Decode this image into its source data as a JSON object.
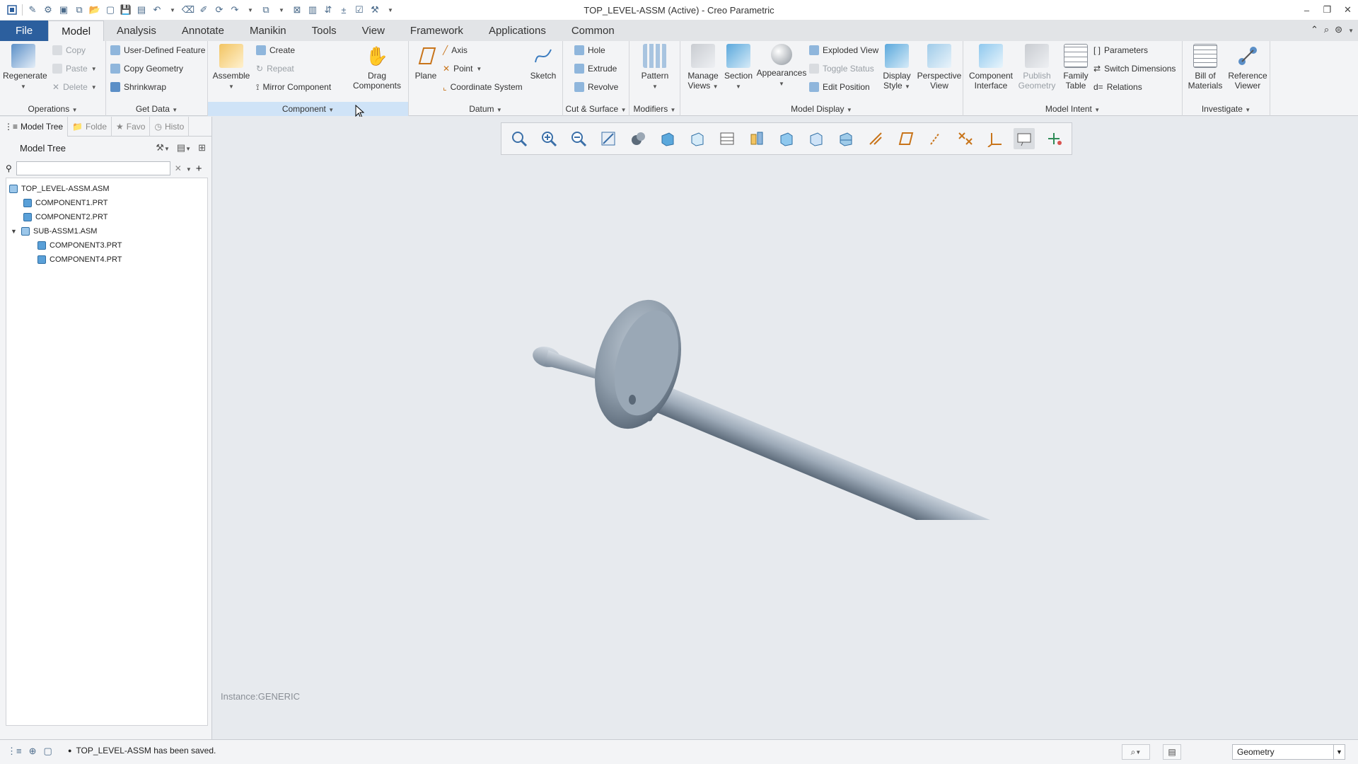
{
  "window": {
    "title": "TOP_LEVEL-ASSM (Active) - Creo Parametric",
    "controls": [
      "–",
      "❐",
      "✕"
    ]
  },
  "tabs": [
    "File",
    "Model",
    "Analysis",
    "Annotate",
    "Manikin",
    "Tools",
    "View",
    "Framework",
    "Applications",
    "Common"
  ],
  "active_tab": "Model",
  "ribbon": {
    "operations": {
      "label": "Operations",
      "regenerate": "Regenerate",
      "copy": "Copy",
      "paste": "Paste",
      "delete": "Delete"
    },
    "get_data": {
      "label": "Get Data",
      "udf": "User-Defined Feature",
      "copy_geometry": "Copy Geometry",
      "shrinkwrap": "Shrinkwrap"
    },
    "component": {
      "label": "Component",
      "assemble": "Assemble",
      "create": "Create",
      "repeat": "Repeat",
      "mirror": "Mirror Component",
      "drag_1": "Drag",
      "drag_2": "Components"
    },
    "datum": {
      "label": "Datum",
      "plane": "Plane",
      "axis": "Axis",
      "point": "Point",
      "csys": "Coordinate System",
      "sketch": "Sketch"
    },
    "cut_surface": {
      "label": "Cut & Surface",
      "hole": "Hole",
      "extrude": "Extrude",
      "revolve": "Revolve"
    },
    "modifiers": {
      "label": "Modifiers",
      "pattern": "Pattern"
    },
    "model_display": {
      "label": "Model Display",
      "manage_1": "Manage",
      "manage_2": "Views",
      "section": "Section",
      "appearances": "Appearances",
      "exploded": "Exploded View",
      "toggle": "Toggle Status",
      "edit_pos": "Edit Position",
      "display_1": "Display",
      "display_2": "Style",
      "persp_1": "Perspective",
      "persp_2": "View"
    },
    "model_intent": {
      "label": "Model Intent",
      "ci_1": "Component",
      "ci_2": "Interface",
      "pg_1": "Publish",
      "pg_2": "Geometry",
      "ft_1": "Family",
      "ft_2": "Table",
      "parameters": "Parameters",
      "switch_dims": "Switch Dimensions",
      "relations": "Relations"
    },
    "investigate": {
      "label": "Investigate",
      "bom_1": "Bill of",
      "bom_2": "Materials",
      "rv_1": "Reference",
      "rv_2": "Viewer"
    }
  },
  "panel": {
    "tabs": [
      "Model Tree",
      "Folde",
      "Favo",
      "Histo"
    ],
    "title": "Model Tree",
    "filter_value": "",
    "tree": [
      {
        "name": "TOP_LEVEL-ASSM.ASM",
        "type": "asm",
        "level": 0
      },
      {
        "name": "COMPONENT1.PRT",
        "type": "prt",
        "level": 1
      },
      {
        "name": "COMPONENT2.PRT",
        "type": "prt",
        "level": 1
      },
      {
        "name": "SUB-ASSM1.ASM",
        "type": "asm",
        "level": 1,
        "expanded": true
      },
      {
        "name": "COMPONENT3.PRT",
        "type": "prt",
        "level": 2
      },
      {
        "name": "COMPONENT4.PRT",
        "type": "prt",
        "level": 2
      }
    ]
  },
  "graphics": {
    "instance": "Instance:GENERIC"
  },
  "status": {
    "message": "TOP_LEVEL-ASSM has been saved.",
    "filter": "Geometry"
  },
  "colors": {
    "file_tab": "#2c5f9e",
    "model_part": "#a9b6c4",
    "highlight": "#cfe3f7"
  }
}
